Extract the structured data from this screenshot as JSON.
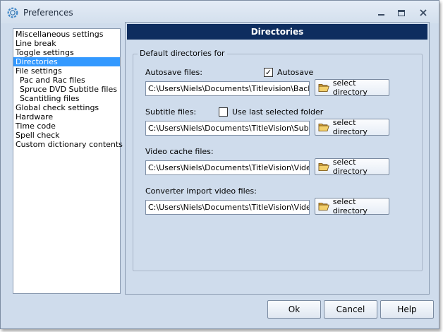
{
  "window": {
    "title": "Preferences",
    "icons": {
      "app": "gear-icon",
      "minimize": "minimize-icon",
      "maximize": "maximize-icon",
      "close": "close-icon"
    }
  },
  "tree": {
    "items": [
      {
        "label": "Miscellaneous settings",
        "child": false,
        "selected": false
      },
      {
        "label": "Line break",
        "child": false,
        "selected": false
      },
      {
        "label": "Toggle settings",
        "child": false,
        "selected": false
      },
      {
        "label": "Directories",
        "child": false,
        "selected": true
      },
      {
        "label": "File settings",
        "child": false,
        "selected": false
      },
      {
        "label": "Pac and Rac files",
        "child": true,
        "selected": false
      },
      {
        "label": "Spruce DVD Subtitle files",
        "child": true,
        "selected": false
      },
      {
        "label": "Scantitling files",
        "child": true,
        "selected": false
      },
      {
        "label": "Global check settings",
        "child": false,
        "selected": false
      },
      {
        "label": "Hardware",
        "child": false,
        "selected": false
      },
      {
        "label": "Time code",
        "child": false,
        "selected": false
      },
      {
        "label": "Spell check",
        "child": false,
        "selected": false
      },
      {
        "label": "Custom dictionary contents",
        "child": false,
        "selected": false
      }
    ]
  },
  "panel": {
    "header": "Directories",
    "group_label": "Default directories for",
    "select_label": "select directory",
    "autosave": {
      "label": "Autosave files:",
      "checkbox_label": "Autosave",
      "checked": true,
      "value": "C:\\Users\\Niels\\Documents\\Titlevision\\Backup"
    },
    "subtitle": {
      "label": "Subtitle files:",
      "checkbox_label": "Use last selected folder",
      "checked": false,
      "value": "C:\\Users\\Niels\\Documents\\TitleVision\\Subtitles"
    },
    "video_cache": {
      "label": "Video cache files:",
      "value": "C:\\Users\\Niels\\Documents\\TitleVision\\Videos"
    },
    "converter": {
      "label": "Converter import video files:",
      "value": "C:\\Users\\Niels\\Documents\\TitleVision\\Videos"
    }
  },
  "footer": {
    "ok": "Ok",
    "cancel": "Cancel",
    "help": "Help"
  },
  "colors": {
    "window_bg": "#cfdcec",
    "header_bg": "#0e2d5f",
    "selection": "#3399ff"
  }
}
